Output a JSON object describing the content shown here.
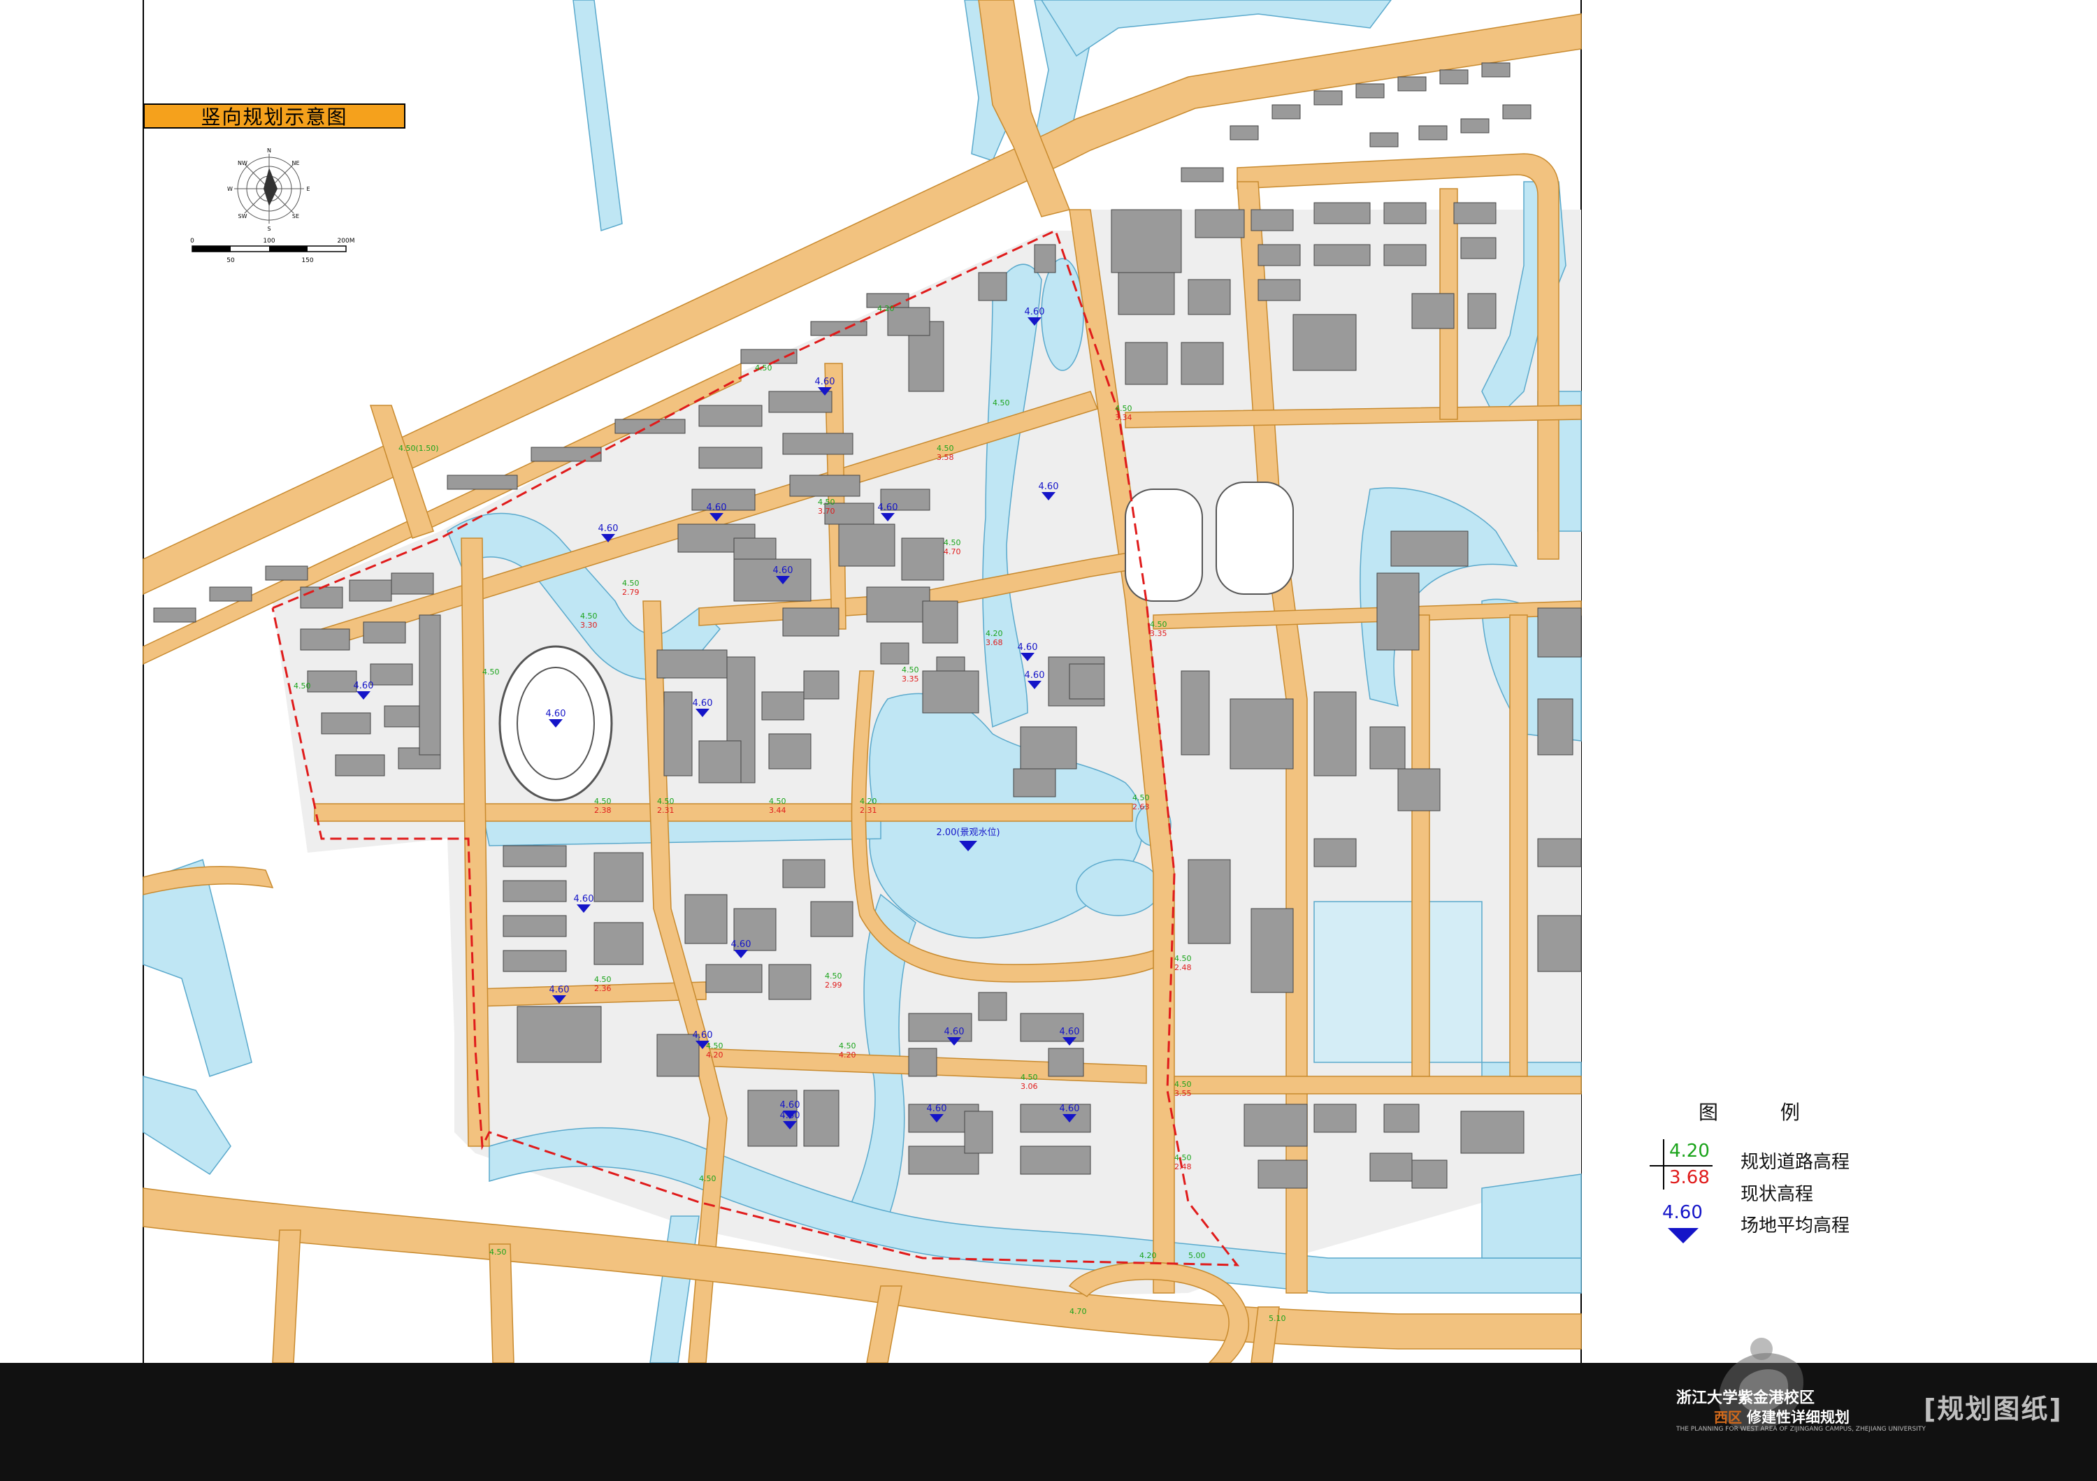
{
  "title": "竖向规划示意图",
  "scale_bar": {
    "labels_top": [
      "0",
      "100",
      "200M"
    ],
    "labels_bottom": [
      "50",
      "150"
    ]
  },
  "compass": {
    "labels": [
      "N",
      "NE",
      "E",
      "SE",
      "S",
      "SW",
      "W",
      "NW"
    ]
  },
  "legend": {
    "title": "图 例",
    "road_value": "4.20",
    "road_label": "规划道路高程",
    "existing_value": "3.68",
    "existing_label": "现状高程",
    "site_value": "4.60",
    "site_label": "场地平均高程"
  },
  "lake_label": "2.00(景观水位)",
  "site_elevations": [
    "4.60",
    "4.60",
    "4.60",
    "4.60",
    "4.60",
    "4.60",
    "4.60",
    "4.60",
    "4.60",
    "4.60",
    "4.60",
    "4.60",
    "4.60",
    "4.60",
    "4.60",
    "4.60",
    "4.60",
    "4.60",
    "4.60",
    "4.60",
    "4.60",
    "4.60"
  ],
  "road_pairs": [
    {
      "g": "4.50",
      "r": "3.34"
    },
    {
      "g": "4.50",
      "r": "3.58"
    },
    {
      "g": "4.50",
      "r": "3.70"
    },
    {
      "g": "4.50",
      "r": "4.70"
    },
    {
      "g": "4.50",
      "r": "2.79"
    },
    {
      "g": "4.50",
      "r": "3.30"
    },
    {
      "g": "4.20",
      "r": "3.68"
    },
    {
      "g": "4.50",
      "r": "3.35"
    },
    {
      "g": "4.50",
      "r": "3.35"
    },
    {
      "g": "4.50",
      "r": "2.38"
    },
    {
      "g": "4.50",
      "r": "2.31"
    },
    {
      "g": "4.50",
      "r": "3.44"
    },
    {
      "g": "4.20",
      "r": "2.31"
    },
    {
      "g": "4.50",
      "r": "2.63"
    },
    {
      "g": "4.50",
      "r": "2.36"
    },
    {
      "g": "4.50",
      "r": "2.99"
    },
    {
      "g": "4.50",
      "r": "2.48"
    },
    {
      "g": "4.50",
      "r": "4.20"
    },
    {
      "g": "4.50",
      "r": "4.20"
    },
    {
      "g": "4.50",
      "r": "3.06"
    },
    {
      "g": "4.50",
      "r": "3.55"
    },
    {
      "g": "4.50",
      "r": "2.48"
    }
  ],
  "road_single": [
    "4.50(1.50)",
    "4.50",
    "4.20",
    "4.50",
    "4.50",
    "4.50",
    "4.70",
    "5.10",
    "4.50",
    "4.20",
    "4.50",
    "5.00"
  ],
  "footer": {
    "title_line1": "浙江大学紫金港校区",
    "west_label": "西区",
    "title_line2": "修建性详细规划",
    "english": "THE PLANNING FOR WEST AREA OF ZIJINGANG CAMPUS, ZHEJIANG UNIVERSITY",
    "bracket_label": "[规划图纸]"
  },
  "colors": {
    "road": "#f2c27f",
    "road_edge": "#c88a2e",
    "water": "#bfe6f4",
    "building": "#9a9a9a",
    "greenfield": "#e9e9e9",
    "green_text": "#1aa31a",
    "red_text": "#e01b1b",
    "blue_marker": "#1414c8",
    "banner": "#f5a11c"
  }
}
